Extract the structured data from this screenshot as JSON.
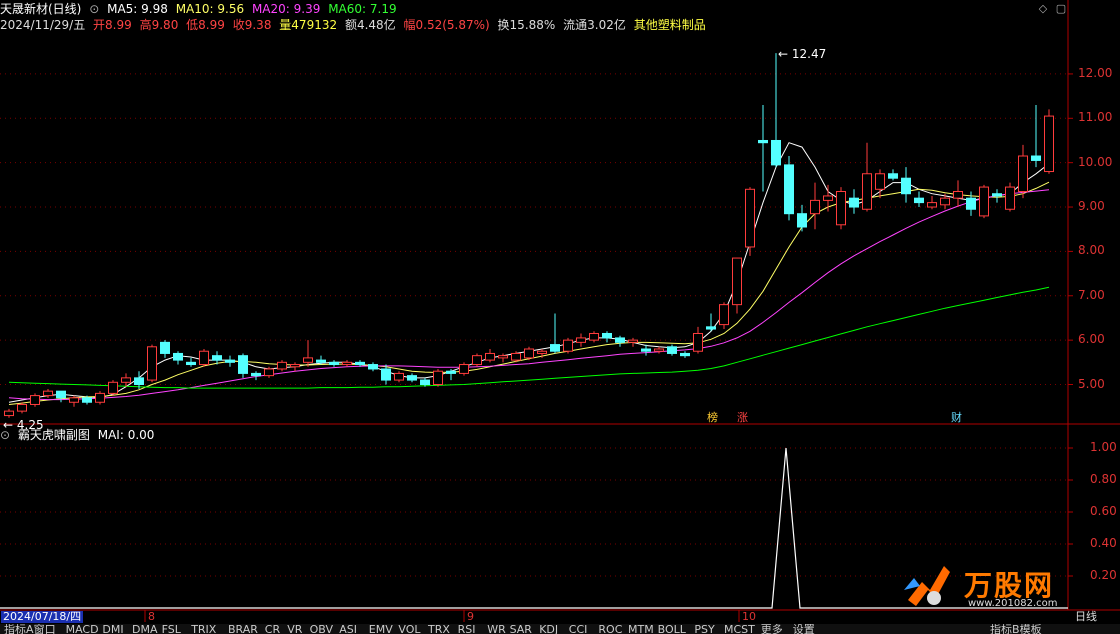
{
  "header": {
    "stock_name": "天晟新材(日线)",
    "ma5": "MA5: 9.98",
    "ma10": "MA10: 9.56",
    "ma20": "MA20: 9.39",
    "ma60": "MA60: 7.19",
    "date": "2024/11/29/五",
    "open": "开8.99",
    "high": "高9.80",
    "low": "低8.99",
    "close": "收9.38",
    "volume": "量479132",
    "amount": "额4.48亿",
    "change": "幅0.52(5.87%)",
    "turnover": "换15.88%",
    "float_cap": "流通3.02亿",
    "sector": "其他塑料制品"
  },
  "subchart": {
    "title": "霸天虎啸副图",
    "mai": "MAI: 0.00"
  },
  "markers": {
    "bang": "榜",
    "zhang": "涨",
    "cai": "财"
  },
  "date_axis": {
    "current": "2024/07/18/四",
    "months": [
      "8",
      "9",
      "10"
    ],
    "right_label": "日线"
  },
  "tabs": [
    "指标A",
    "窗口",
    "MACD",
    "DMI",
    "DMA",
    "FSL",
    "TRIX",
    "BRAR",
    "CR",
    "VR",
    "OBV",
    "ASI",
    "EMV",
    "VOL",
    "TRX",
    "RSI",
    "WR",
    "SAR",
    "KDJ",
    "CCI",
    "ROC",
    "MTM",
    "BOLL",
    "PSY",
    "MCST",
    "更多",
    "设置",
    "指标B",
    "模板"
  ],
  "logo": {
    "text": "万股网",
    "url": "www.201082.com"
  },
  "colors": {
    "up": "#ff3c3c",
    "down": "#54ffff",
    "ma5": "#ffffff",
    "ma10": "#ffff66",
    "ma20": "#ff44ff",
    "ma60": "#00ff00",
    "axis": "#b00000",
    "mai": "#ffffff"
  },
  "chart_data": [
    {
      "type": "candlestick",
      "title": "天晟新材(日线)",
      "ylim": [
        4.2,
        12.9
      ],
      "yticks": [
        5.0,
        6.0,
        7.0,
        8.0,
        9.0,
        10.0,
        11.0,
        12.0
      ],
      "annotations": [
        {
          "label": "12.47",
          "value": 12.47
        },
        {
          "label": "4.25",
          "value": 4.25
        }
      ],
      "candles": [
        {
          "o": 4.3,
          "h": 4.45,
          "l": 4.25,
          "c": 4.4
        },
        {
          "o": 4.4,
          "h": 4.6,
          "l": 4.35,
          "c": 4.55
        },
        {
          "o": 4.55,
          "h": 4.8,
          "l": 4.5,
          "c": 4.75
        },
        {
          "o": 4.75,
          "h": 4.9,
          "l": 4.7,
          "c": 4.85
        },
        {
          "o": 4.85,
          "h": 4.85,
          "l": 4.6,
          "c": 4.7
        },
        {
          "o": 4.6,
          "h": 4.75,
          "l": 4.5,
          "c": 4.7
        },
        {
          "o": 4.7,
          "h": 4.75,
          "l": 4.55,
          "c": 4.6
        },
        {
          "o": 4.6,
          "h": 4.85,
          "l": 4.55,
          "c": 4.8
        },
        {
          "o": 4.8,
          "h": 5.1,
          "l": 4.75,
          "c": 5.05
        },
        {
          "o": 5.05,
          "h": 5.25,
          "l": 4.95,
          "c": 5.15
        },
        {
          "o": 5.15,
          "h": 5.3,
          "l": 4.9,
          "c": 5.0
        },
        {
          "o": 5.1,
          "h": 5.9,
          "l": 5.05,
          "c": 5.85
        },
        {
          "o": 5.95,
          "h": 6.0,
          "l": 5.6,
          "c": 5.7
        },
        {
          "o": 5.7,
          "h": 5.75,
          "l": 5.45,
          "c": 5.55
        },
        {
          "o": 5.5,
          "h": 5.6,
          "l": 5.4,
          "c": 5.45
        },
        {
          "o": 5.45,
          "h": 5.8,
          "l": 5.4,
          "c": 5.75
        },
        {
          "o": 5.65,
          "h": 5.75,
          "l": 5.45,
          "c": 5.55
        },
        {
          "o": 5.55,
          "h": 5.65,
          "l": 5.4,
          "c": 5.5
        },
        {
          "o": 5.65,
          "h": 5.7,
          "l": 5.15,
          "c": 5.25
        },
        {
          "o": 5.25,
          "h": 5.3,
          "l": 5.1,
          "c": 5.2
        },
        {
          "o": 5.2,
          "h": 5.4,
          "l": 5.15,
          "c": 5.35
        },
        {
          "o": 5.35,
          "h": 5.55,
          "l": 5.3,
          "c": 5.5
        },
        {
          "o": 5.4,
          "h": 5.5,
          "l": 5.3,
          "c": 5.45
        },
        {
          "o": 5.5,
          "h": 6.0,
          "l": 5.4,
          "c": 5.6
        },
        {
          "o": 5.55,
          "h": 5.65,
          "l": 5.45,
          "c": 5.5
        },
        {
          "o": 5.5,
          "h": 5.55,
          "l": 5.4,
          "c": 5.45
        },
        {
          "o": 5.45,
          "h": 5.55,
          "l": 5.4,
          "c": 5.5
        },
        {
          "o": 5.5,
          "h": 5.55,
          "l": 5.4,
          "c": 5.45
        },
        {
          "o": 5.45,
          "h": 5.5,
          "l": 5.3,
          "c": 5.35
        },
        {
          "o": 5.35,
          "h": 5.45,
          "l": 5.0,
          "c": 5.1
        },
        {
          "o": 5.1,
          "h": 5.3,
          "l": 5.05,
          "c": 5.25
        },
        {
          "o": 5.2,
          "h": 5.25,
          "l": 5.05,
          "c": 5.1
        },
        {
          "o": 5.1,
          "h": 5.15,
          "l": 4.95,
          "c": 5.0
        },
        {
          "o": 5.0,
          "h": 5.35,
          "l": 4.95,
          "c": 5.3
        },
        {
          "o": 5.3,
          "h": 5.35,
          "l": 5.1,
          "c": 5.25
        },
        {
          "o": 5.25,
          "h": 5.5,
          "l": 5.2,
          "c": 5.45
        },
        {
          "o": 5.45,
          "h": 5.7,
          "l": 5.4,
          "c": 5.65
        },
        {
          "o": 5.55,
          "h": 5.8,
          "l": 5.5,
          "c": 5.7
        },
        {
          "o": 5.6,
          "h": 5.7,
          "l": 5.5,
          "c": 5.65
        },
        {
          "o": 5.55,
          "h": 5.75,
          "l": 5.5,
          "c": 5.7
        },
        {
          "o": 5.6,
          "h": 5.85,
          "l": 5.55,
          "c": 5.8
        },
        {
          "o": 5.7,
          "h": 5.8,
          "l": 5.6,
          "c": 5.75
        },
        {
          "o": 5.9,
          "h": 6.6,
          "l": 5.7,
          "c": 5.75
        },
        {
          "o": 5.75,
          "h": 6.05,
          "l": 5.7,
          "c": 6.0
        },
        {
          "o": 5.95,
          "h": 6.15,
          "l": 5.85,
          "c": 6.05
        },
        {
          "o": 6.0,
          "h": 6.2,
          "l": 5.95,
          "c": 6.15
        },
        {
          "o": 6.15,
          "h": 6.2,
          "l": 5.95,
          "c": 6.05
        },
        {
          "o": 6.05,
          "h": 6.1,
          "l": 5.85,
          "c": 5.95
        },
        {
          "o": 5.95,
          "h": 6.05,
          "l": 5.85,
          "c": 6.0
        },
        {
          "o": 5.8,
          "h": 5.9,
          "l": 5.65,
          "c": 5.75
        },
        {
          "o": 5.75,
          "h": 5.85,
          "l": 5.7,
          "c": 5.8
        },
        {
          "o": 5.85,
          "h": 5.9,
          "l": 5.65,
          "c": 5.7
        },
        {
          "o": 5.7,
          "h": 5.75,
          "l": 5.6,
          "c": 5.65
        },
        {
          "o": 5.75,
          "h": 6.3,
          "l": 5.7,
          "c": 6.15
        },
        {
          "o": 6.3,
          "h": 6.6,
          "l": 6.2,
          "c": 6.25
        },
        {
          "o": 6.35,
          "h": 6.85,
          "l": 6.25,
          "c": 6.8
        },
        {
          "o": 6.8,
          "h": 7.85,
          "l": 6.6,
          "c": 7.85
        },
        {
          "o": 8.1,
          "h": 9.45,
          "l": 7.9,
          "c": 9.4
        },
        {
          "o": 10.5,
          "h": 11.3,
          "l": 9.35,
          "c": 10.45
        },
        {
          "o": 10.5,
          "h": 12.47,
          "l": 9.9,
          "c": 9.95
        },
        {
          "o": 9.95,
          "h": 10.15,
          "l": 8.7,
          "c": 8.85
        },
        {
          "o": 8.85,
          "h": 9.05,
          "l": 8.45,
          "c": 8.55
        },
        {
          "o": 8.85,
          "h": 9.55,
          "l": 8.5,
          "c": 9.15
        },
        {
          "o": 9.15,
          "h": 9.5,
          "l": 8.9,
          "c": 9.25
        },
        {
          "o": 8.6,
          "h": 9.45,
          "l": 8.5,
          "c": 9.35
        },
        {
          "o": 9.2,
          "h": 9.4,
          "l": 8.85,
          "c": 9.0
        },
        {
          "o": 8.95,
          "h": 10.45,
          "l": 8.9,
          "c": 9.75
        },
        {
          "o": 9.4,
          "h": 9.85,
          "l": 9.2,
          "c": 9.75
        },
        {
          "o": 9.75,
          "h": 9.85,
          "l": 9.6,
          "c": 9.65
        },
        {
          "o": 9.65,
          "h": 9.9,
          "l": 9.1,
          "c": 9.3
        },
        {
          "o": 9.2,
          "h": 9.35,
          "l": 9.0,
          "c": 9.1
        },
        {
          "o": 9.0,
          "h": 9.25,
          "l": 8.95,
          "c": 9.1
        },
        {
          "o": 9.05,
          "h": 9.3,
          "l": 8.95,
          "c": 9.2
        },
        {
          "o": 9.2,
          "h": 9.6,
          "l": 9.0,
          "c": 9.35
        },
        {
          "o": 9.2,
          "h": 9.35,
          "l": 8.8,
          "c": 8.95
        },
        {
          "o": 8.8,
          "h": 9.5,
          "l": 8.75,
          "c": 9.45
        },
        {
          "o": 9.3,
          "h": 9.4,
          "l": 9.1,
          "c": 9.25
        },
        {
          "o": 8.95,
          "h": 9.55,
          "l": 8.9,
          "c": 9.45
        },
        {
          "o": 9.35,
          "h": 10.4,
          "l": 9.2,
          "c": 10.15
        },
        {
          "o": 10.15,
          "h": 11.3,
          "l": 9.9,
          "c": 10.05
        },
        {
          "o": 9.8,
          "h": 11.2,
          "l": 9.75,
          "c": 11.05
        }
      ],
      "ma_series": [
        {
          "name": "MA5",
          "key": "ma5",
          "start": 0,
          "values": [
            4.6,
            4.65,
            4.7,
            4.75,
            4.78,
            4.75,
            4.72,
            4.7,
            4.78,
            4.95,
            5.15,
            5.4,
            5.55,
            5.65,
            5.62,
            5.55,
            5.55,
            5.55,
            5.5,
            5.4,
            5.35,
            5.38,
            5.4,
            5.45,
            5.48,
            5.5,
            5.5,
            5.45,
            5.4,
            5.3,
            5.2,
            5.15,
            5.15,
            5.2,
            5.3,
            5.4,
            5.5,
            5.6,
            5.65,
            5.7,
            5.75,
            5.8,
            5.85,
            5.92,
            6.0,
            6.05,
            6.05,
            6.02,
            5.95,
            5.88,
            5.85,
            5.83,
            5.85,
            5.95,
            6.2,
            6.6,
            7.3,
            8.2,
            9.1,
            9.9,
            10.45,
            10.35,
            9.9,
            9.35,
            9.15,
            9.05,
            9.15,
            9.35,
            9.55,
            9.55,
            9.4,
            9.3,
            9.25,
            9.2,
            9.15,
            9.2,
            9.25,
            9.3,
            9.55,
            9.75,
            9.98
          ]
        },
        {
          "name": "MA10",
          "key": "ma10",
          "start": 0,
          "values": [
            4.55,
            4.58,
            4.62,
            4.65,
            4.68,
            4.7,
            4.72,
            4.73,
            4.76,
            4.8,
            4.88,
            5.0,
            5.1,
            5.22,
            5.32,
            5.42,
            5.48,
            5.52,
            5.52,
            5.5,
            5.47,
            5.45,
            5.44,
            5.44,
            5.45,
            5.46,
            5.46,
            5.45,
            5.43,
            5.4,
            5.35,
            5.3,
            5.28,
            5.27,
            5.28,
            5.3,
            5.34,
            5.4,
            5.46,
            5.52,
            5.58,
            5.64,
            5.7,
            5.75,
            5.8,
            5.85,
            5.9,
            5.93,
            5.95,
            5.95,
            5.94,
            5.93,
            5.92,
            5.94,
            6.02,
            6.15,
            6.38,
            6.7,
            7.1,
            7.6,
            8.1,
            8.55,
            8.85,
            9.0,
            9.1,
            9.15,
            9.2,
            9.25,
            9.3,
            9.35,
            9.4,
            9.38,
            9.32,
            9.28,
            9.25,
            9.23,
            9.22,
            9.24,
            9.3,
            9.42,
            9.56
          ]
        },
        {
          "name": "MA20",
          "key": "ma20",
          "start": 0,
          "values": [
            4.7,
            4.68,
            4.67,
            4.66,
            4.66,
            4.67,
            4.68,
            4.69,
            4.71,
            4.73,
            4.76,
            4.8,
            4.84,
            4.88,
            4.93,
            4.98,
            5.03,
            5.08,
            5.13,
            5.18,
            5.22,
            5.26,
            5.3,
            5.33,
            5.36,
            5.38,
            5.4,
            5.41,
            5.42,
            5.42,
            5.42,
            5.41,
            5.4,
            5.39,
            5.39,
            5.39,
            5.4,
            5.41,
            5.43,
            5.45,
            5.47,
            5.5,
            5.53,
            5.56,
            5.59,
            5.62,
            5.65,
            5.68,
            5.7,
            5.72,
            5.74,
            5.76,
            5.78,
            5.81,
            5.86,
            5.94,
            6.05,
            6.2,
            6.4,
            6.62,
            6.85,
            7.07,
            7.3,
            7.52,
            7.72,
            7.9,
            8.06,
            8.22,
            8.37,
            8.52,
            8.66,
            8.79,
            8.91,
            9.02,
            9.12,
            9.2,
            9.26,
            9.3,
            9.33,
            9.36,
            9.39
          ]
        },
        {
          "name": "MA60",
          "key": "ma60",
          "start": 0,
          "values": [
            5.05,
            5.04,
            5.03,
            5.02,
            5.01,
            5.0,
            4.99,
            4.98,
            4.97,
            4.96,
            4.95,
            4.94,
            4.93,
            4.93,
            4.92,
            4.92,
            4.92,
            4.92,
            4.92,
            4.92,
            4.92,
            4.92,
            4.92,
            4.92,
            4.93,
            4.93,
            4.93,
            4.94,
            4.94,
            4.95,
            4.95,
            4.96,
            4.97,
            4.98,
            4.99,
            5.0,
            5.02,
            5.04,
            5.06,
            5.08,
            5.1,
            5.12,
            5.14,
            5.16,
            5.18,
            5.2,
            5.22,
            5.24,
            5.25,
            5.26,
            5.27,
            5.28,
            5.3,
            5.32,
            5.36,
            5.42,
            5.5,
            5.58,
            5.66,
            5.74,
            5.82,
            5.9,
            5.98,
            6.06,
            6.14,
            6.22,
            6.3,
            6.37,
            6.44,
            6.51,
            6.58,
            6.65,
            6.72,
            6.78,
            6.84,
            6.9,
            6.96,
            7.02,
            7.08,
            7.13,
            7.19
          ]
        }
      ]
    },
    {
      "type": "line",
      "title": "霸天虎啸副图",
      "ylim": [
        0,
        1.1
      ],
      "yticks": [
        0.2,
        0.4,
        0.6,
        0.8,
        1.0
      ],
      "series": [
        {
          "name": "MAI",
          "spike_index": 59,
          "spike_value": 1.0
        }
      ]
    }
  ]
}
